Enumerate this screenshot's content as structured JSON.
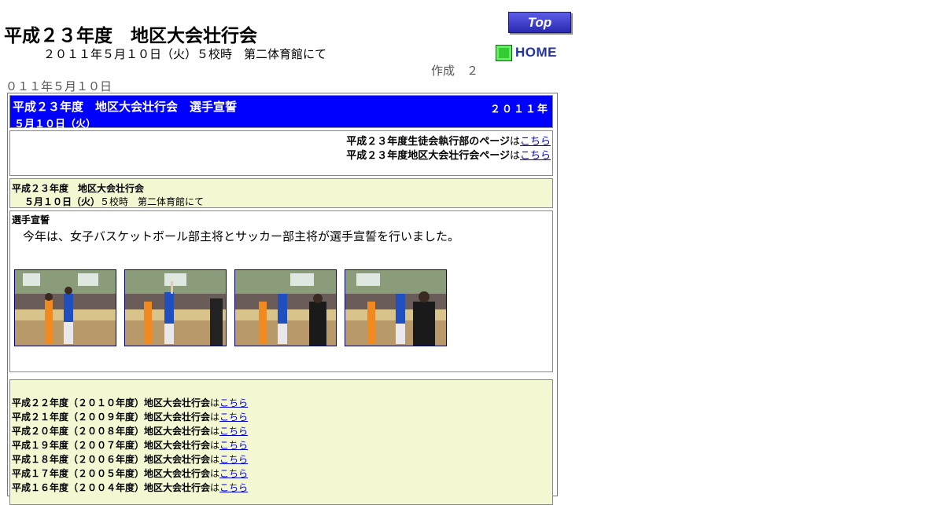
{
  "page": {
    "title": "平成２３年度　地区大会壮行会",
    "subtitle": "２０１１年５月１０日（火）５校時　第二体育館にて",
    "created_label": "作成　２",
    "created_date": "０１１年５月１０日"
  },
  "nav": {
    "top_label": "Top",
    "home_label": "HOME"
  },
  "header": {
    "title": "平成２３年度　地区大会壮行会　選手宣誓",
    "year": "２０１１年",
    "date": "５月１０日（火）"
  },
  "links": [
    {
      "text": "平成２３年度生徒会執行部のページ",
      "connector": "は",
      "link": "こちら"
    },
    {
      "text": "平成２３年度地区大会壮行会ページ",
      "connector": "は",
      "link": "こちら"
    }
  ],
  "event": {
    "title": "平成２３年度　地区大会壮行会",
    "date": "５月１０日（火）",
    "detail": "５校時　第二体育館にて"
  },
  "section": {
    "heading": "選手宣誓",
    "text": "今年は、女子バスケットボール部主将とサッカー部主将が選手宣誓を行いました。"
  },
  "history": [
    {
      "text": "平成２２年度（２０１０年度）地区大会壮行会",
      "connector": "は",
      "link": "こちら"
    },
    {
      "text": "平成２１年度（２００９年度）地区大会壮行会",
      "connector": "は",
      "link": "こちら"
    },
    {
      "text": "平成２０年度（２００８年度）地区大会壮行会",
      "connector": "は",
      "link": "こちら"
    },
    {
      "text": "平成１９年度（２００７年度）地区大会壮行会",
      "connector": "は",
      "link": "こちら"
    },
    {
      "text": "平成１８年度（２００６年度）地区大会壮行会",
      "connector": "は",
      "link": "こちら"
    },
    {
      "text": "平成１７年度（２００５年度）地区大会壮行会",
      "connector": "は",
      "link": "こちら"
    },
    {
      "text": "平成１６年度（２００４年度）地区大会壮行会",
      "connector": "は",
      "link": "こちら"
    }
  ],
  "colors": {
    "header_bg": "#0000ff",
    "panel_bg": "#f3f7d2",
    "link": "#0000cc"
  }
}
